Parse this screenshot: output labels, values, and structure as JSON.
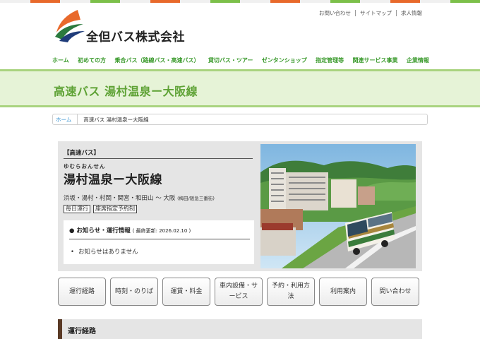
{
  "brand": {
    "name": "全但バス株式会社",
    "colors": {
      "green": "#5ea235",
      "nav_green": "#3a9a2c",
      "orange": "#e8692b",
      "navy": "#1f3c7a"
    }
  },
  "top_stripe": [
    "#f0f0f0",
    "#e8692b",
    "#f0f0f0",
    "#7cc04a",
    "#f0f0f0",
    "#e8692b",
    "#f0f0f0",
    "#7cc04a",
    "#f0f0f0",
    "#e8692b",
    "#f0f0f0",
    "#7cc04a",
    "#f0f0f0",
    "#e8692b",
    "#f0f0f0",
    "#7cc04a"
  ],
  "utility_links": [
    "お問い合わせ",
    "サイトマップ",
    "求人情報"
  ],
  "global_nav": [
    "ホーム",
    "初めての方",
    "乗合バス（路線バス・高速バス）",
    "貸切バス・ツアー",
    "ゼンタンショップ",
    "指定管理等",
    "関連サービス事業",
    "企業情報"
  ],
  "page_title": "高速バス 湯村温泉ー大阪線",
  "breadcrumb": {
    "home": "ホーム",
    "current": "高速バス 湯村温泉ー大阪線"
  },
  "route": {
    "category": "【高速バス】",
    "ruby": "ゆむらおんせん",
    "name": "湯村温泉ー大阪線",
    "stops": "浜坂・湯村・村岡・関宮・和田山 〜 大阪",
    "stops_note": "(梅田/阪急三番街)",
    "tags": [
      "毎日運行",
      "座席指定予約制"
    ]
  },
  "notice": {
    "heading": "● お知らせ・運行情報",
    "updated": "( 最終更新: 2026.02.10 )",
    "items": [
      "お知らせはありません"
    ]
  },
  "photo_icon": "bus-townscape-photo",
  "tabs": [
    "運行経路",
    "時刻・のりば",
    "運賃・料金",
    "車内設備・サービス",
    "予約・利用方法",
    "利用案内",
    "問い合わせ"
  ],
  "section": {
    "title": "運行経路"
  }
}
